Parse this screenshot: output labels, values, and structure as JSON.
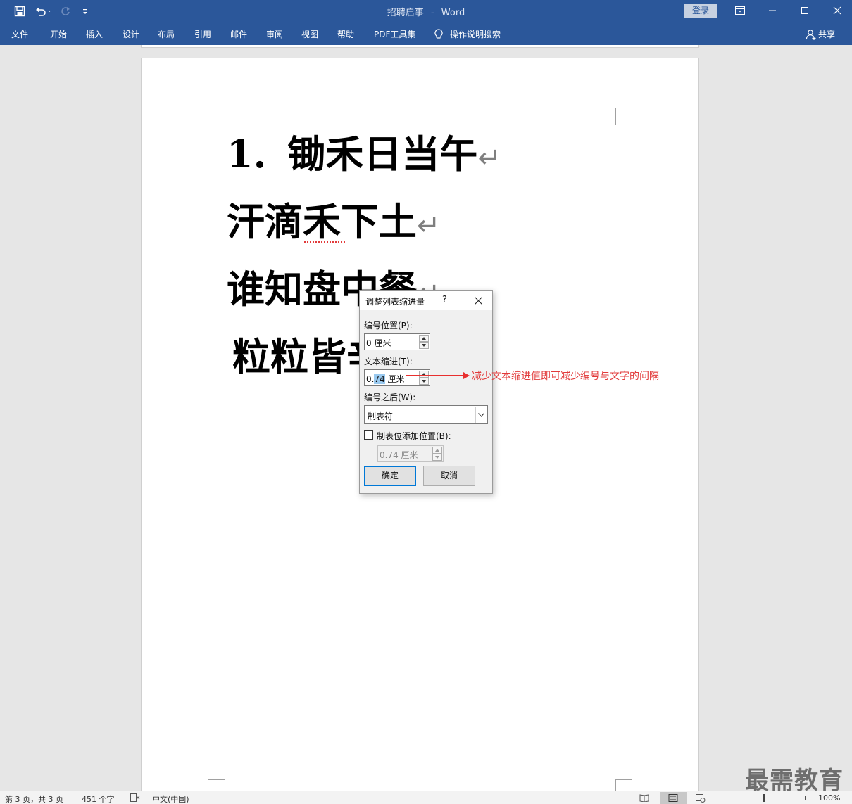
{
  "app": {
    "doc_title": "招聘启事",
    "app_name": "Word",
    "title_sep": "-",
    "login_label": "登录"
  },
  "ribbon": {
    "tabs": [
      "文件",
      "开始",
      "插入",
      "设计",
      "布局",
      "引用",
      "邮件",
      "审阅",
      "视图",
      "帮助",
      "PDF工具集"
    ],
    "tell_me": "操作说明搜索",
    "share_label": "共享"
  },
  "document": {
    "lines": [
      "1.",
      "锄禾日当午",
      "汗滴禾下土",
      "谁知盘中餐",
      "粒粒皆辛"
    ]
  },
  "dialog": {
    "title": "调整列表缩进量",
    "help": "?",
    "number_position_label": "编号位置(P):",
    "number_position_value": "0 厘米",
    "text_indent_label": "文本缩进(T):",
    "text_indent_value_pre": "0.",
    "text_indent_value_sel": "74",
    "text_indent_value_post": " 厘米",
    "follow_number_label": "编号之后(W):",
    "follow_number_value": "制表符",
    "tab_stop_label": "制表位添加位置(B):",
    "tab_stop_value": "0.74 厘米",
    "tab_stop_checked": false,
    "ok_label": "确定",
    "cancel_label": "取消"
  },
  "annotation": {
    "text": "减少文本缩进值即可减少编号与文字的间隔",
    "color": "#e23b3b"
  },
  "status": {
    "page": "第 3 页，共 3 页",
    "words": "451 个字",
    "language": "中文(中国)",
    "zoom_minus": "−",
    "zoom_plus": "+",
    "zoom": "100%"
  },
  "watermark": "最需教育",
  "colors": {
    "ribbon": "#2b579a",
    "accent": "#0078d7"
  }
}
